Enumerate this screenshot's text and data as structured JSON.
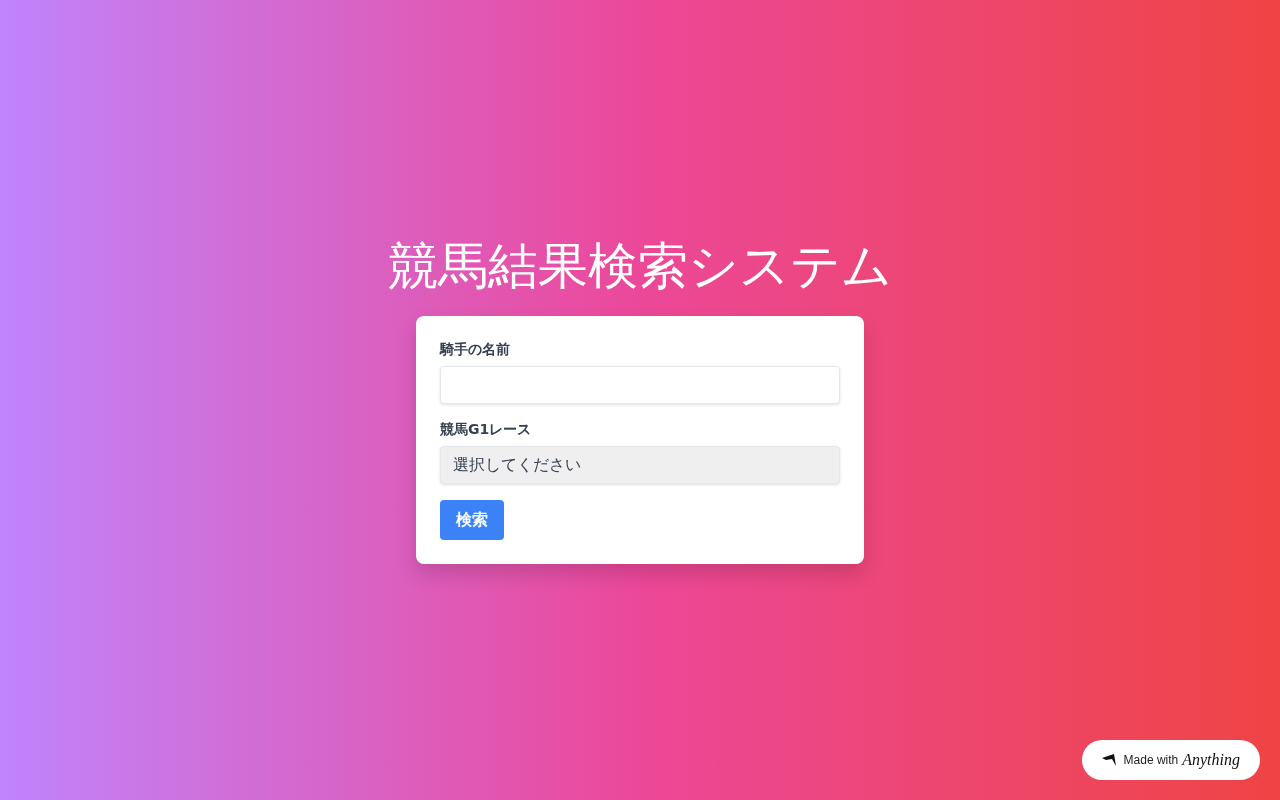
{
  "title": "競馬結果検索システム",
  "form": {
    "fields": [
      {
        "kind": "text",
        "label": "騎手の名前"
      },
      {
        "kind": "select",
        "label": "競馬G1レース",
        "value": "選択してください"
      }
    ],
    "submit": "検索"
  },
  "badge": {
    "text": "Made with",
    "brand": "Anything"
  }
}
